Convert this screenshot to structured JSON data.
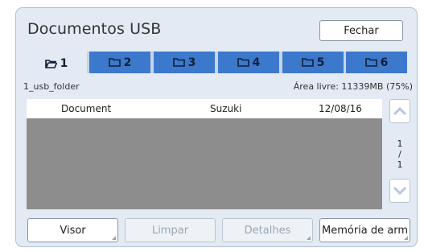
{
  "window": {
    "title": "Documentos USB",
    "close_label": "Fechar"
  },
  "tabs": [
    {
      "label": "1",
      "icon": "folder-open-icon",
      "active": true
    },
    {
      "label": "2",
      "icon": "folder-icon",
      "active": false
    },
    {
      "label": "3",
      "icon": "folder-icon",
      "active": false
    },
    {
      "label": "4",
      "icon": "folder-icon",
      "active": false
    },
    {
      "label": "5",
      "icon": "folder-icon",
      "active": false
    },
    {
      "label": "6",
      "icon": "folder-icon",
      "active": false
    }
  ],
  "folder": {
    "name": "1_usb_folder",
    "free_space": "Área livre: 11339MB (75%)"
  },
  "list": {
    "rows": [
      {
        "name": "Document",
        "owner": "Suzuki",
        "date": "12/08/16"
      }
    ]
  },
  "pager": {
    "current": "1",
    "separator": "/",
    "total": "1"
  },
  "buttons": {
    "visor": "Visor",
    "limpar": "Limpar",
    "detalhes": "Detalhes",
    "memoria": "Memória de arm"
  },
  "colors": {
    "accent": "#3c79cd",
    "panel": "#e3eaf4",
    "list_bg": "#8d8d8d"
  }
}
